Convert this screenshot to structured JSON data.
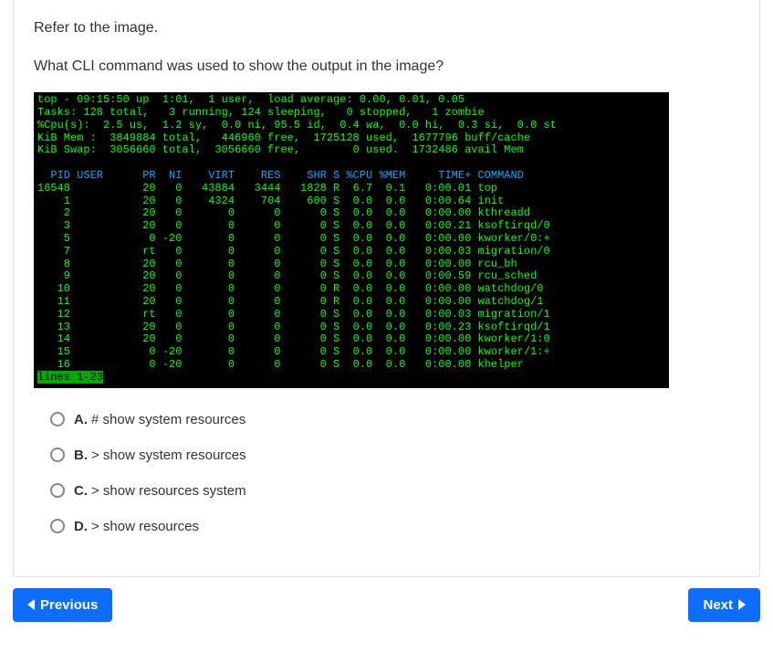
{
  "question": {
    "intro": "Refer to the image.",
    "prompt": "What CLI command was used to show the output in the image?"
  },
  "terminal": {
    "summary": [
      "top - 09:15:50 up  1:01,  1 user,  load average: 0.00, 0.01, 0.05",
      "Tasks: 128 total,   3 running, 124 sleeping,   0 stopped,   1 zombie",
      "%Cpu(s):  2.5 us,  1.2 sy,  0.0 ni, 95.5 id,  0.4 wa,  0.0 hi,  0.3 si,  0.0 st",
      "KiB Mem :  3849884 total,   446960 free,  1725128 used,  1677796 buff/cache",
      "KiB Swap:  3056660 total,  3056660 free,        0 used.  1732486 avail Mem"
    ],
    "columns": "  PID USER      PR  NI    VIRT    RES    SHR S %CPU %MEM     TIME+ COMMAND",
    "rows": [
      "16548           20   0   43884   3444   1828 R  6.7  0.1   0:00.01 top",
      "    1           20   0    4324    704    600 S  0.0  0.0   0:00.64 init",
      "    2           20   0       0      0      0 S  0.0  0.0   0:00.00 kthreadd",
      "    3           20   0       0      0      0 S  0.0  0.0   0:00.21 ksoftirqd/0",
      "    5            0 -20       0      0      0 S  0.0  0.0   0:00.00 kworker/0:+",
      "    7           rt   0       0      0      0 S  0.0  0.0   0:00.03 migration/0",
      "    8           20   0       0      0      0 S  0.0  0.0   0:00.00 rcu_bh",
      "    9           20   0       0      0      0 S  0.0  0.0   0:00.59 rcu_sched",
      "   10           20   0       0      0      0 R  0.0  0.0   0:00.00 watchdog/0",
      "   11           20   0       0      0      0 R  0.0  0.0   0:00.00 watchdog/1",
      "   12           rt   0       0      0      0 S  0.0  0.0   0:00.03 migration/1",
      "   13           20   0       0      0      0 S  0.0  0.0   0:00.23 ksoftirqd/1",
      "   14           20   0       0      0      0 S  0.0  0.0   0:00.00 kworker/1:0",
      "   15            0 -20       0      0      0 S  0.0  0.0   0:00.00 kworker/1:+",
      "   16            0 -20       0      0      0 S  0.0  0.0   0:00.00 khelper"
    ],
    "status": "lines 1-23"
  },
  "options": {
    "a": {
      "letter": "A.",
      "text": "# show system resources"
    },
    "b": {
      "letter": "B.",
      "text": "> show system resources"
    },
    "c": {
      "letter": "C.",
      "text": "> show resources system"
    },
    "d": {
      "letter": "D.",
      "text": "> show resources"
    }
  },
  "nav": {
    "prev": "Previous",
    "next": "Next"
  }
}
